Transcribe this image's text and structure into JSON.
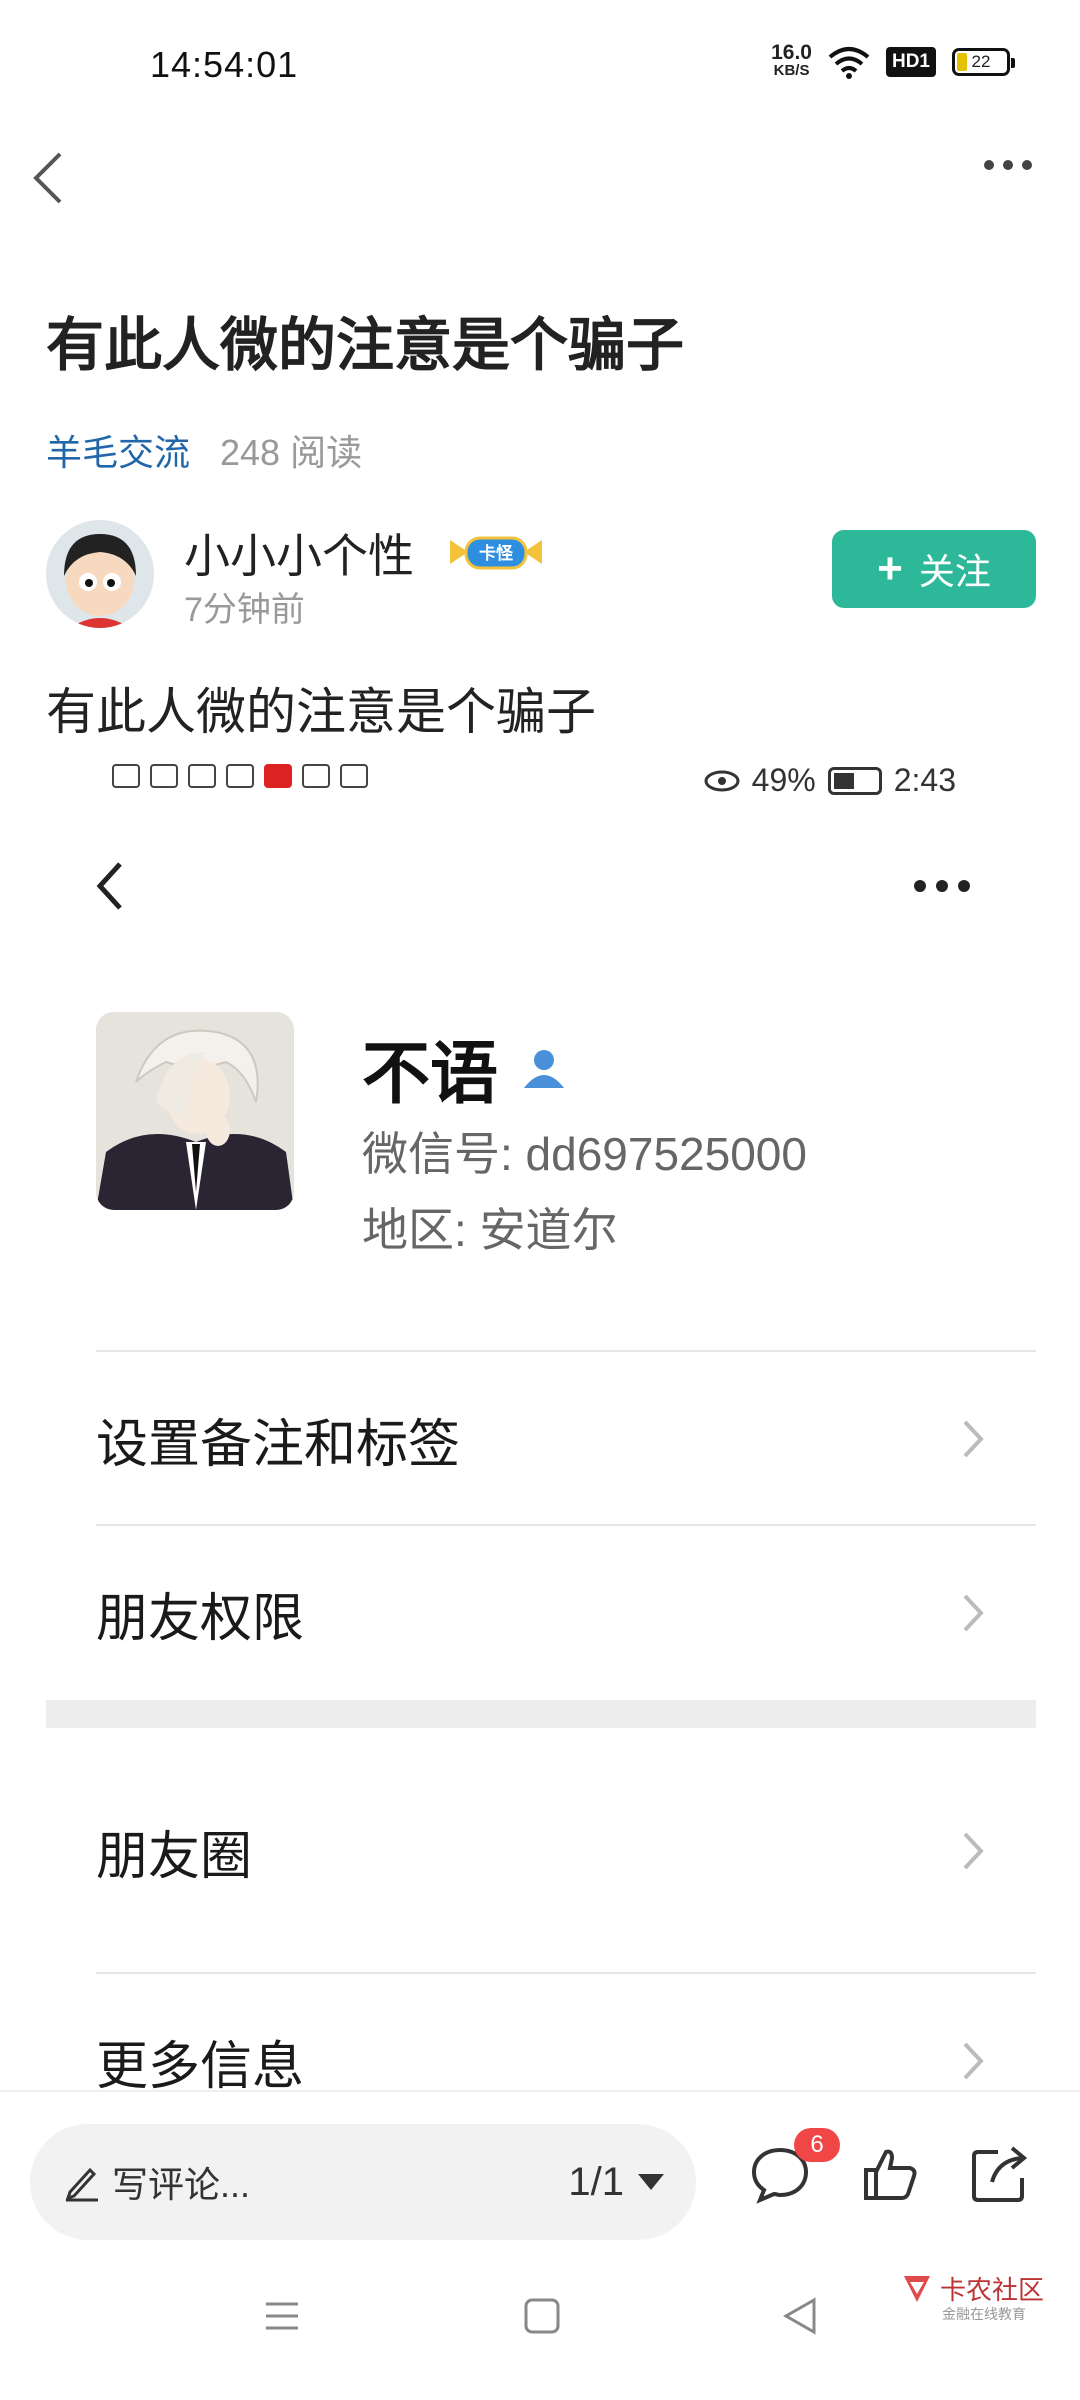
{
  "status_bar": {
    "time": "14:54:01",
    "speed_value": "16.0",
    "speed_unit": "KB/S",
    "hd_label": "HD1",
    "battery": "22"
  },
  "post": {
    "title": "有此人微的注意是个骗子",
    "category": "羊毛交流",
    "reads": "248 阅读",
    "author_name": "小小小个性",
    "author_badge": "卡怪",
    "post_time": "7分钟前",
    "follow_label": "关注",
    "follow_plus": "+",
    "body": "有此人微的注意是个骗子"
  },
  "embedded_screenshot": {
    "status": {
      "battery_pct": "49%",
      "time": "2:43"
    },
    "profile": {
      "name": "不语",
      "wechat_id": "微信号:  dd697525000",
      "region": "地区:  安道尔"
    },
    "menu": [
      {
        "label": "设置备注和标签"
      },
      {
        "label": "朋友权限"
      },
      {
        "label": "朋友圈"
      },
      {
        "label": "更多信息"
      }
    ]
  },
  "bottom_bar": {
    "comment_placeholder": "写评论...",
    "page_indicator": "1/1",
    "comment_count": "6"
  },
  "watermark": {
    "brand": "卡农社区",
    "sub": "金融在线教育"
  }
}
